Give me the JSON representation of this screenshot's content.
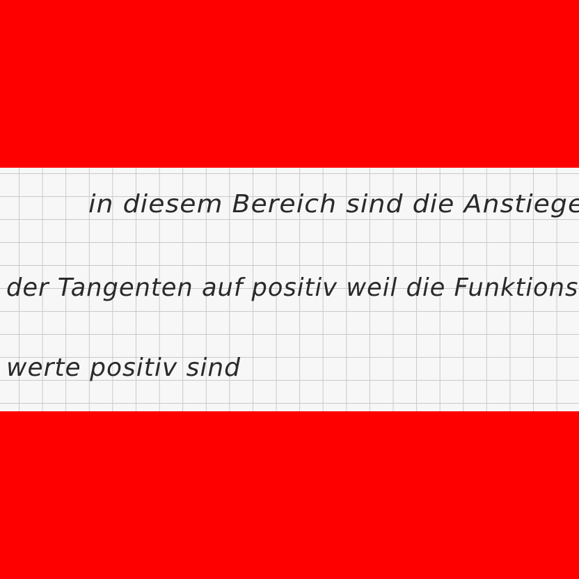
{
  "document": {
    "lines": [
      "in diesem Bereich sind die Anstiege",
      "der Tangenten auf positiv weil die Funktions",
      "werte positiv sind"
    ]
  },
  "colors": {
    "border": "#ff0000",
    "paper": "#f7f7f7",
    "grid": "#c9c9c9",
    "ink": "#2a2a2a"
  }
}
